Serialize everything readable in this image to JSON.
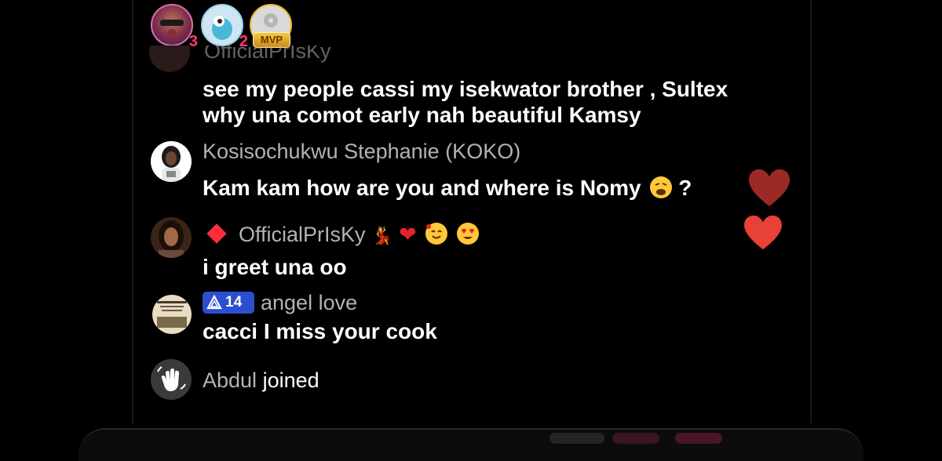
{
  "top_viewers": [
    {
      "name": "viewer-avatar-1",
      "rank": "3"
    },
    {
      "name": "viewer-avatar-2",
      "rank": "2"
    },
    {
      "name": "viewer-avatar-mvp",
      "badge": "MVP"
    }
  ],
  "comments": {
    "faded": {
      "username": "OfficialPrIsKy",
      "text_line1": "see my people cassi  my isekwator brother , Sultex",
      "text_line2": "why una comot early nah beautiful  Kamsy"
    },
    "koko": {
      "username": "Kosisochukwu Stephanie (KOKO)",
      "text": "Kam kam how are you and where is Nomy",
      "trailing": "?"
    },
    "prisky": {
      "username": "OfficialPrIsKy",
      "text": "i greet una oo"
    },
    "angel": {
      "level": "14",
      "username": "angel love",
      "text": "cacci  I miss your cook"
    }
  },
  "join_event": {
    "username": "Abdul",
    "action": "joined"
  },
  "colors": {
    "background": "#000000",
    "username_gray": "#b3b3b3",
    "heart_red": "#e8222c",
    "level_blue": "#2c4fcf",
    "mvp_gold": "#f2b632"
  },
  "icons": [
    "diamond-icon",
    "heart-icon",
    "wave-hand-icon",
    "level-triangle-icon"
  ]
}
